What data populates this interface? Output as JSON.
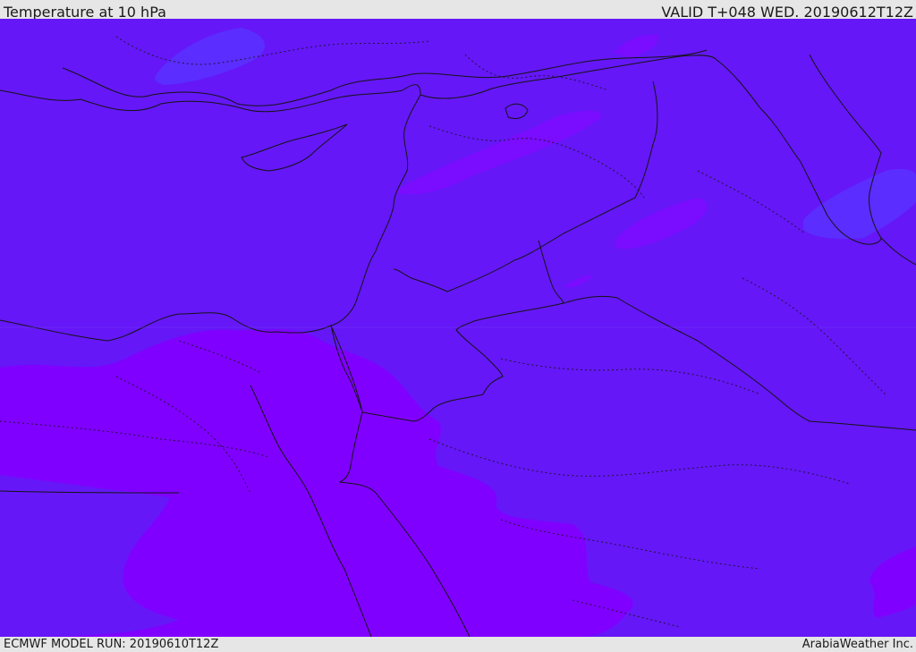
{
  "header": {
    "title": "Temperature at 10 hPa",
    "valid_time": "VALID T+048 WED. 20190612T12Z"
  },
  "footer": {
    "model_run": "ECMWF MODEL RUN: 20190610T12Z",
    "credit": "ArabiaWeather Inc."
  },
  "map": {
    "region": "Eastern Mediterranean and Middle East",
    "colors": {
      "base_field": "#6517f7",
      "warm_field": "#8000ff",
      "cool_field": "#5b2dff",
      "border": "#141414"
    }
  }
}
